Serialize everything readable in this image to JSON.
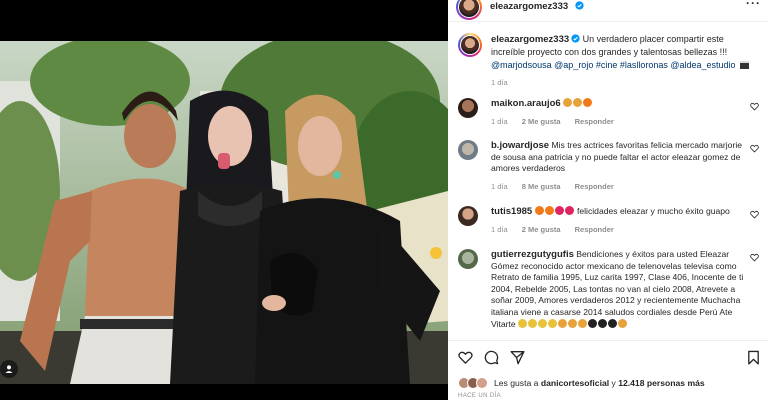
{
  "header": {
    "username": "eleazargomez333",
    "more_label": "···"
  },
  "caption": {
    "username": "eleazargomez333",
    "text": " Un verdadero placer compartir este increíble proyecto con dos grandes y talentosas bellezas !!! ",
    "tags": "@marjodsousa @ap_rojo #cine #laslloronas @aldea_estudio",
    "time": "1 día"
  },
  "comments": [
    {
      "username": "maikon.araujo6",
      "text": "",
      "time": "1 día",
      "likes": "2 Me gusta",
      "reply": "Responder",
      "emoji_colors": [
        "#e8a23a",
        "#e8a23a",
        "#f07a18"
      ]
    },
    {
      "username": "b.jowardjose",
      "text": "Mis tres actrices favoritas felicia mercado marjorie de sousa ana patricia y no puede faltar el actor eleazar gomez de amores verdaderos",
      "time": "1 día",
      "likes": "8 Me gusta",
      "reply": "Responder",
      "emoji_colors": []
    },
    {
      "username": "tutis1985",
      "text": "felicidades eleazar y mucho éxito guapo",
      "time": "1 día",
      "likes": "2 Me gusta",
      "reply": "Responder",
      "emoji_colors": [
        "#f07a18",
        "#f07a18",
        "#e0245e",
        "#e0245e"
      ]
    },
    {
      "username": "gutierrezgutygufis",
      "text": "Bendiciones y éxitos para usted Eleazar Gómez reconocido actor mexicano de telenovelas televisa como Retrato de familia 1995, Luz carita 1997, Clase 406, Inocente de ti 2004, Rebelde 2005, Las tontas no van al cielo 2008, Atrevete a soñar 2009, Amores verdaderos 2012 y recientemente Muchacha italiana viene a casarse 2014 saludos cordiales desde Perú Ate Vitarte",
      "time": "",
      "likes": "",
      "reply": "",
      "emoji_colors": [
        "#e8c23a",
        "#e8c23a",
        "#e8c23a",
        "#e8c23a",
        "#e8a23a",
        "#e8a23a",
        "#e8a23a",
        "#222",
        "#222",
        "#222",
        "#e8a23a"
      ]
    }
  ],
  "likes": {
    "prefix": "Les gusta a ",
    "user": "danicortesoficial",
    "middle": " y ",
    "count": "12.418 personas más"
  },
  "posted_ago": "HACE UN DÍA",
  "colors": {
    "link": "#00376b",
    "muted": "#8e8e8e",
    "verified": "#0095f6"
  }
}
